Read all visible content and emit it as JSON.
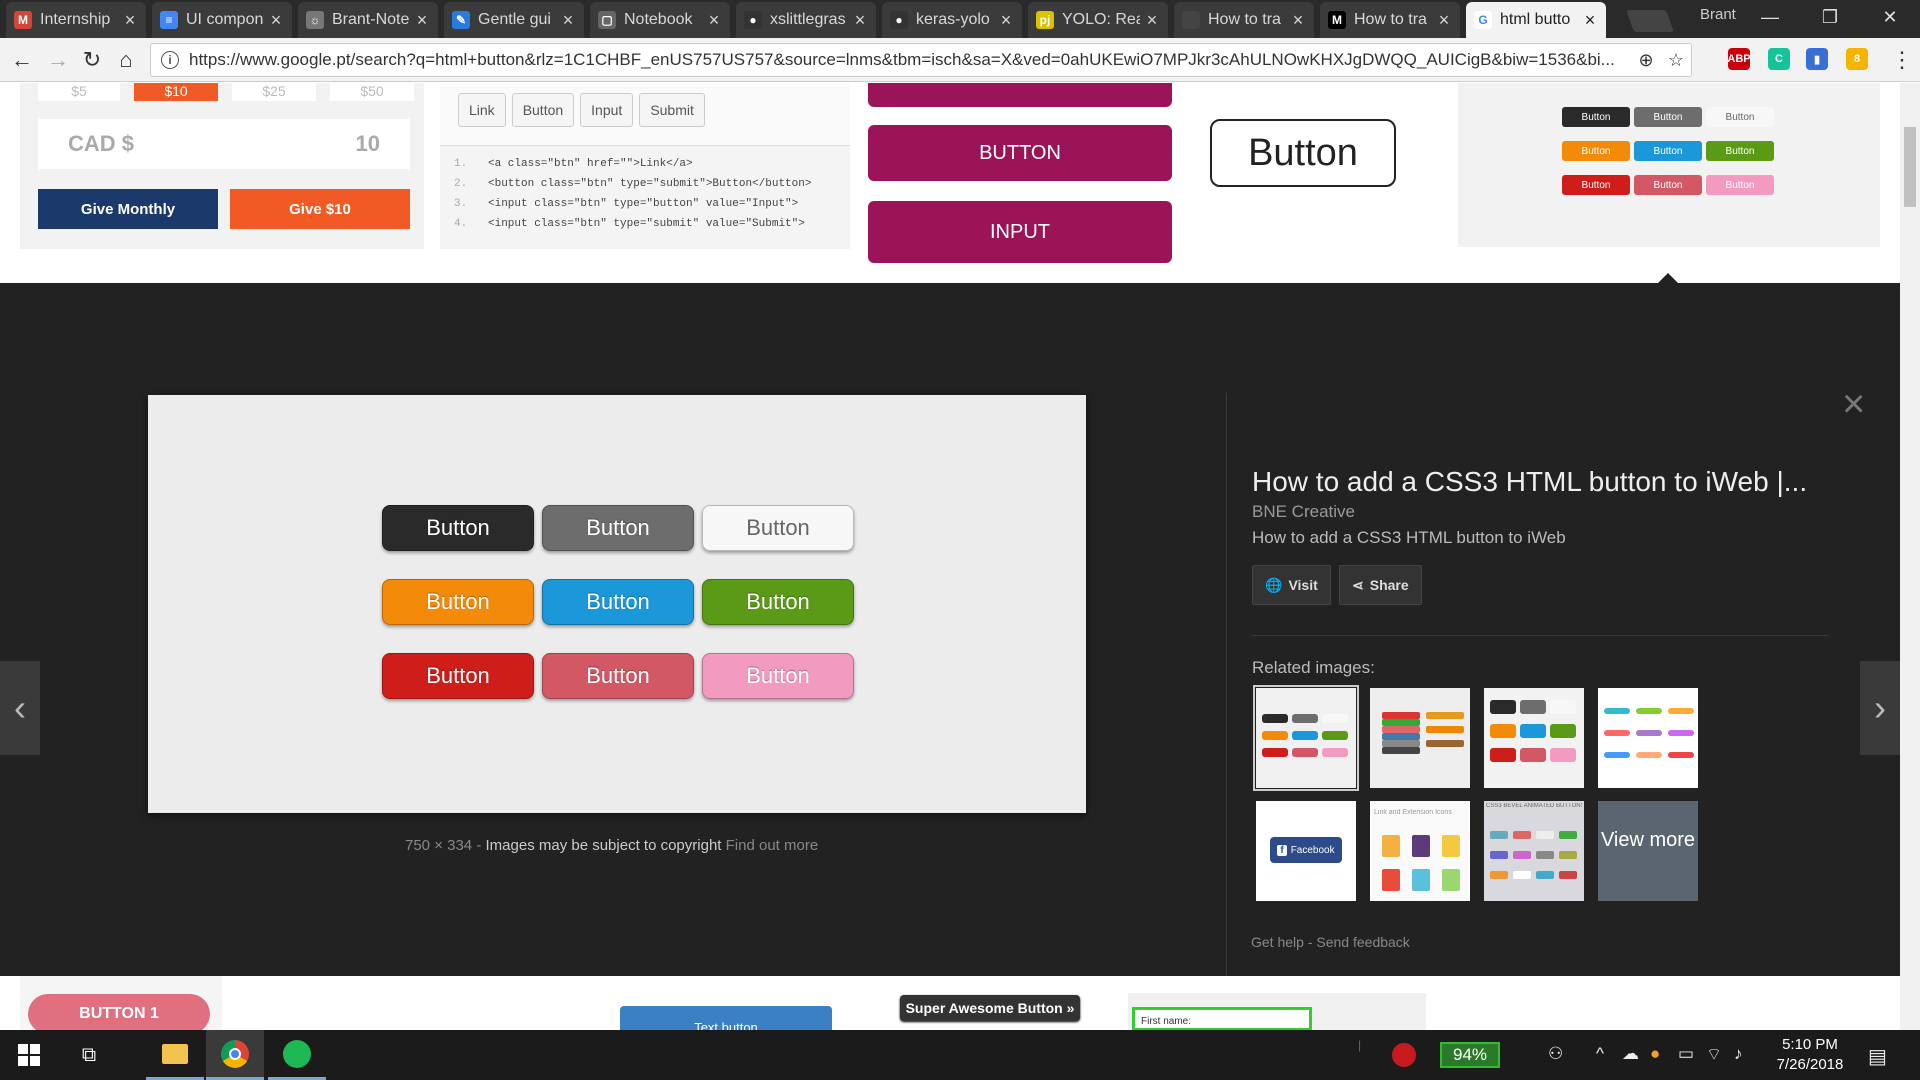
{
  "browser": {
    "tabs": [
      {
        "title": "Internship",
        "favicon": "gmail-icon",
        "color": "#d44638",
        "glyph": "M"
      },
      {
        "title": "UI compon",
        "favicon": "docs-icon",
        "color": "#4285f4",
        "glyph": "≡"
      },
      {
        "title": "Brant-Note",
        "favicon": "jupyter-icon",
        "color": "#777777",
        "glyph": "☼"
      },
      {
        "title": "Gentle gui",
        "favicon": "blog-icon",
        "color": "#2a7ae2",
        "glyph": "✎"
      },
      {
        "title": "Notebook",
        "favicon": "page-icon",
        "color": "#666666",
        "glyph": "▢"
      },
      {
        "title": "xslittlegras",
        "favicon": "github-icon",
        "color": "#333333",
        "glyph": "●"
      },
      {
        "title": "keras-yolo",
        "favicon": "github-icon",
        "color": "#333333",
        "glyph": "●"
      },
      {
        "title": "YOLO: Real",
        "favicon": "pj-icon",
        "color": "#d9c200",
        "glyph": "pj"
      },
      {
        "title": "How to tra",
        "favicon": "blank-icon",
        "color": "#444444",
        "glyph": ""
      },
      {
        "title": "How to tra",
        "favicon": "medium-icon",
        "color": "#000000",
        "glyph": "M"
      },
      {
        "title": "html butto",
        "favicon": "google-icon",
        "color": "#ffffff",
        "glyph": "G",
        "active": true
      }
    ],
    "profile_name": "Brant",
    "url": "https://www.google.pt/search?q=html+button&rlz=1C1CHBF_enUS757US757&source=lnms&tbm=isch&sa=X&ved=0ahUKEwiO7MPJkr3cAhULNOwKHXJgDWQQ_AUICigB&biw=1536&bi...",
    "extensions": [
      {
        "name": "adblock-icon",
        "label": "ABP",
        "color": "#c7000b",
        "badge": "1"
      },
      {
        "name": "grammarly-icon",
        "label": "C",
        "color": "#15c39a"
      },
      {
        "name": "bookmark-ext-icon",
        "label": "▮",
        "color": "#3a6fd8"
      },
      {
        "name": "keep-icon",
        "label": "8",
        "color": "#f4b400",
        "badge": "8"
      }
    ]
  },
  "top_strip": {
    "donation": {
      "amounts": [
        "$5",
        "$10",
        "$25",
        "$50"
      ],
      "currency_label": "CAD $",
      "amount_value": "10",
      "give_monthly": "Give Monthly",
      "give_once": "Give $10"
    },
    "code_sample": {
      "buttons": [
        "Link",
        "Button",
        "Input",
        "Submit"
      ],
      "lines": [
        "<a class=\"btn\" href=\"\">Link</a>",
        "<button class=\"btn\" type=\"submit\">Button</button>",
        "<input class=\"btn\" type=\"button\" value=\"Input\">",
        "<input class=\"btn\" type=\"submit\" value=\"Submit\">"
      ],
      "line_numbers": [
        "1.",
        "2.",
        "3.",
        "4."
      ]
    },
    "magenta_buttons": [
      "BUTTON",
      "INPUT"
    ],
    "outline_button": "Button",
    "mini_grid_label": "Button"
  },
  "viewer": {
    "preview_buttons": [
      {
        "label": "Button",
        "color": "#2a2a2a"
      },
      {
        "label": "Button",
        "color": "#6d6d6d"
      },
      {
        "label": "Button",
        "color": "#f7f7f7",
        "text_color": "#666666"
      },
      {
        "label": "Button",
        "color": "#f38a08"
      },
      {
        "label": "Button",
        "color": "#1b98d9"
      },
      {
        "label": "Button",
        "color": "#5a9a16"
      },
      {
        "label": "Button",
        "color": "#cf1e1a"
      },
      {
        "label": "Button",
        "color": "#d35865"
      },
      {
        "label": "Button",
        "color": "#f29abf"
      }
    ],
    "dimensions": "750 × 334",
    "separator": "-",
    "copyright": "Images may be subject to copyright",
    "find_out_more": "Find out more",
    "title": "How to add a CSS3 HTML button to iWeb |...",
    "source": "BNE Creative",
    "description": "How to add a CSS3 HTML button to iWeb",
    "visit_label": "Visit",
    "share_label": "Share",
    "related_label": "Related images:",
    "related_facebook": "Facebook",
    "related_link_ext": "Link and Extension Icons",
    "related_bevel": "CSS3 BEVEL ANIMATED BUTTONS",
    "view_more": "View more",
    "get_help": "Get help",
    "send_feedback": "Send feedback",
    "footer_sep": "-"
  },
  "bottom_strip": {
    "button1": "BUTTON 1",
    "text_button": "Text button",
    "super_awesome": "Super Awesome Button »",
    "first_name": "First name:"
  },
  "taskbar": {
    "battery": "94%",
    "time": "5:10 PM",
    "date": "7/26/2018"
  }
}
